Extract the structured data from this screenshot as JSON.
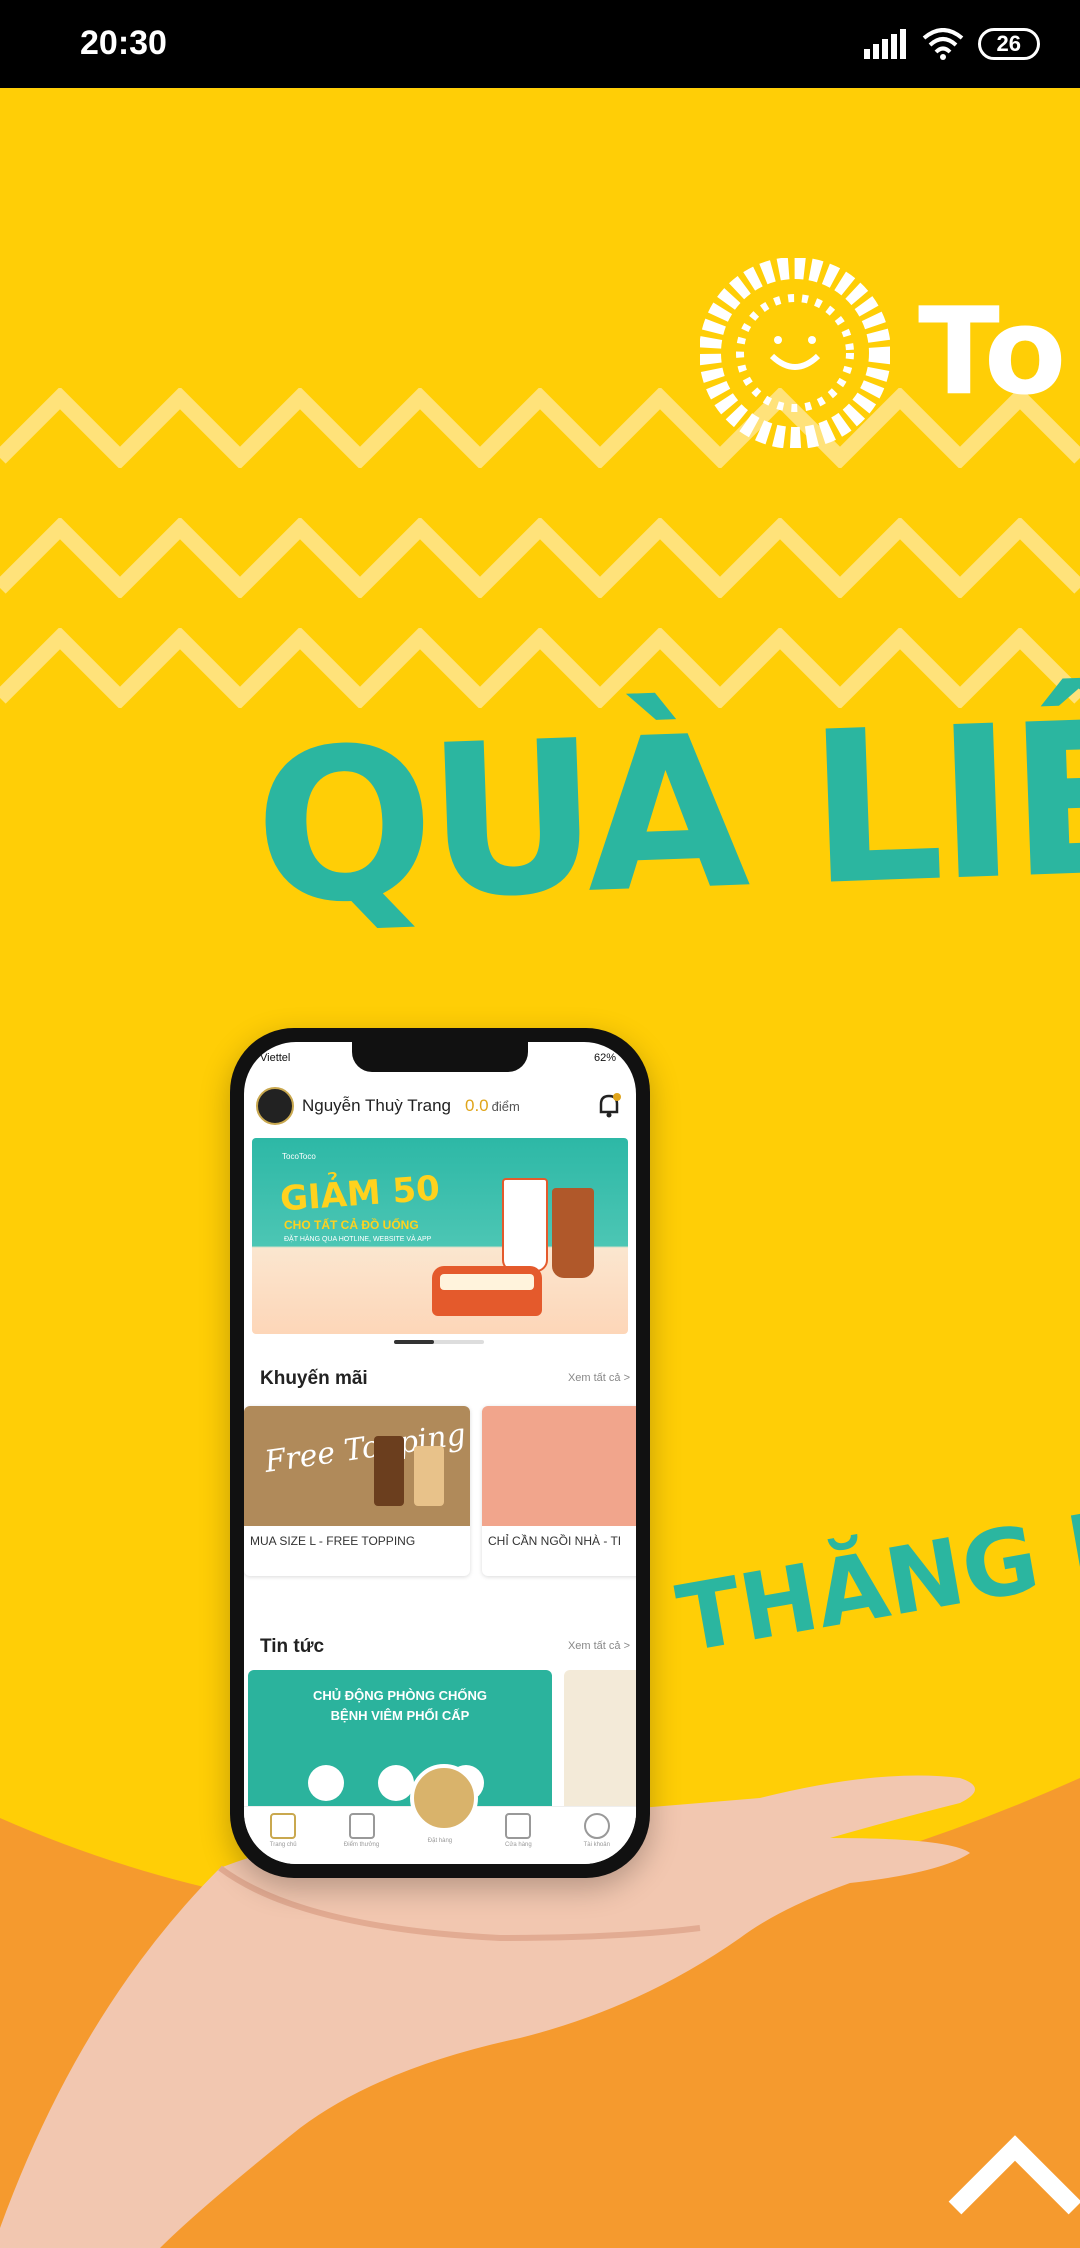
{
  "status_bar": {
    "time": "20:30",
    "battery": "26"
  },
  "ad": {
    "brand_partial": "To",
    "headline": "QUÀ LIỀN",
    "subline": "THĂNG HẠ",
    "colors": {
      "background": "#FFCE06",
      "accent": "#2BB6A0",
      "orange": "#F59A2E"
    }
  },
  "phone": {
    "carrier": "Viettel",
    "battery": "62%",
    "user_name": "Nguyễn Thuỳ Trang",
    "points_value": "0.0",
    "points_label": "điểm",
    "banner": {
      "badge": "TocoToco",
      "title": "GIẢM 50",
      "subtitle": "CHO TẤT CẢ ĐỒ UỐNG",
      "small": "ĐẶT HÀNG QUA HOTLINE, WEBSITE VÀ APP"
    },
    "promotions": {
      "title": "Khuyến mãi",
      "see_all": "Xem tất cả >",
      "items": [
        {
          "label": "MUA SIZE L - FREE TOPPING",
          "image_text": "Free Topping"
        },
        {
          "label": "CHỈ CẦN NGỒI NHÀ - TI"
        }
      ]
    },
    "news": {
      "title": "Tin tức",
      "see_all": "Xem tất cả >",
      "card_line1": "CHỦ ĐỘNG PHÒNG CHỐNG",
      "card_line2": "BỆNH VIÊM PHỔI CẤP"
    },
    "tabs": [
      "Trang chủ",
      "Điểm thưởng",
      "Đặt hàng",
      "Cửa hàng",
      "Tài khoản"
    ]
  }
}
